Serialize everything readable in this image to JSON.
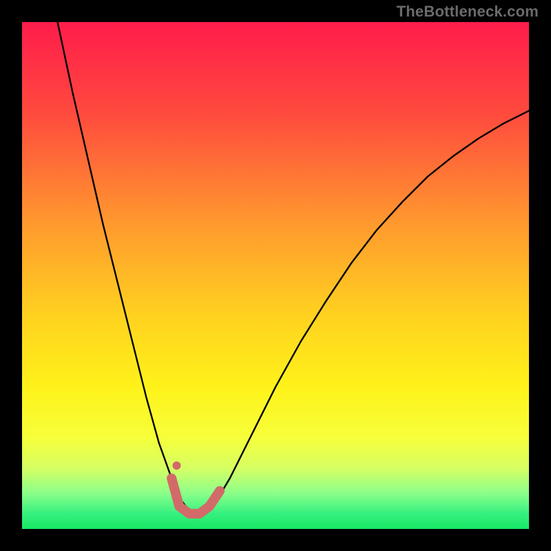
{
  "watermark": "TheBottleneck.com",
  "chart_data": {
    "type": "line",
    "title": "",
    "xlabel": "",
    "ylabel": "",
    "xlim": [
      0,
      1
    ],
    "ylim": [
      0,
      1
    ],
    "grid": false,
    "legend": false,
    "series": [
      {
        "name": "bottleneck-curve",
        "color": "#000000",
        "x": [
          0.07,
          0.1,
          0.13,
          0.16,
          0.19,
          0.22,
          0.245,
          0.27,
          0.295,
          0.315,
          0.335,
          0.355,
          0.38,
          0.41,
          0.45,
          0.5,
          0.55,
          0.6,
          0.65,
          0.7,
          0.75,
          0.8,
          0.85,
          0.9,
          0.95,
          1.0
        ],
        "y": [
          1.0,
          0.86,
          0.73,
          0.6,
          0.48,
          0.36,
          0.26,
          0.17,
          0.1,
          0.055,
          0.03,
          0.03,
          0.05,
          0.1,
          0.18,
          0.28,
          0.37,
          0.45,
          0.525,
          0.59,
          0.645,
          0.695,
          0.735,
          0.77,
          0.8,
          0.825
        ]
      },
      {
        "name": "optimal-highlight",
        "color": "#d26a69",
        "x": [
          0.295,
          0.31,
          0.33,
          0.35,
          0.37,
          0.39
        ],
        "y": [
          0.1,
          0.045,
          0.03,
          0.03,
          0.045,
          0.075
        ]
      }
    ],
    "markers": [
      {
        "name": "optimal-dot",
        "x": 0.305,
        "y": 0.125,
        "color": "#d26a69",
        "r": 6
      }
    ],
    "background_gradient": {
      "stops": [
        {
          "offset": 0.0,
          "color": "#ff1c4b"
        },
        {
          "offset": 0.18,
          "color": "#ff4a3e"
        },
        {
          "offset": 0.4,
          "color": "#ff9a2e"
        },
        {
          "offset": 0.58,
          "color": "#ffd21f"
        },
        {
          "offset": 0.72,
          "color": "#fff21a"
        },
        {
          "offset": 0.82,
          "color": "#f6ff3a"
        },
        {
          "offset": 0.88,
          "color": "#d6ff63"
        },
        {
          "offset": 0.93,
          "color": "#8aff8a"
        },
        {
          "offset": 0.97,
          "color": "#35f07f"
        },
        {
          "offset": 1.0,
          "color": "#18e865"
        }
      ]
    }
  }
}
